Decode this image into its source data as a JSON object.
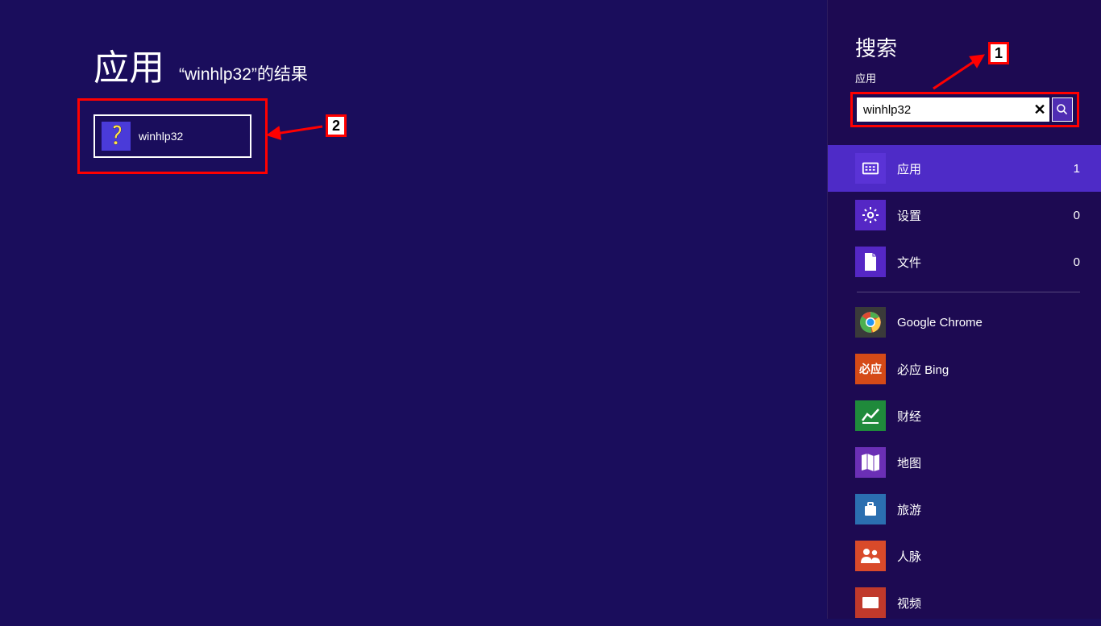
{
  "main": {
    "title": "应用",
    "subtitle": "“winhlp32”的结果",
    "result_label": "winhlp32"
  },
  "annotations": {
    "num1": "1",
    "num2": "2"
  },
  "sidebar": {
    "title": "搜索",
    "subtitle": "应用",
    "search_value": "winhlp32",
    "scopes": [
      {
        "label": "应用",
        "count": "1",
        "icon": "apps",
        "active": true
      },
      {
        "label": "设置",
        "count": "0",
        "icon": "settings",
        "active": false
      },
      {
        "label": "文件",
        "count": "0",
        "icon": "file",
        "active": false
      }
    ],
    "providers": [
      {
        "label": "Google Chrome",
        "icon": "chrome",
        "bg": "#3a3a3a"
      },
      {
        "label": "必应 Bing",
        "icon": "bing",
        "bg": "#d54a17"
      },
      {
        "label": "财经",
        "icon": "finance",
        "bg": "#1f8a3b"
      },
      {
        "label": "地图",
        "icon": "maps",
        "bg": "#6b2fb5"
      },
      {
        "label": "旅游",
        "icon": "travel",
        "bg": "#2b6fb0"
      },
      {
        "label": "人脉",
        "icon": "people",
        "bg": "#d94a2a"
      },
      {
        "label": "视频",
        "icon": "video",
        "bg": "#c0392b"
      }
    ]
  }
}
